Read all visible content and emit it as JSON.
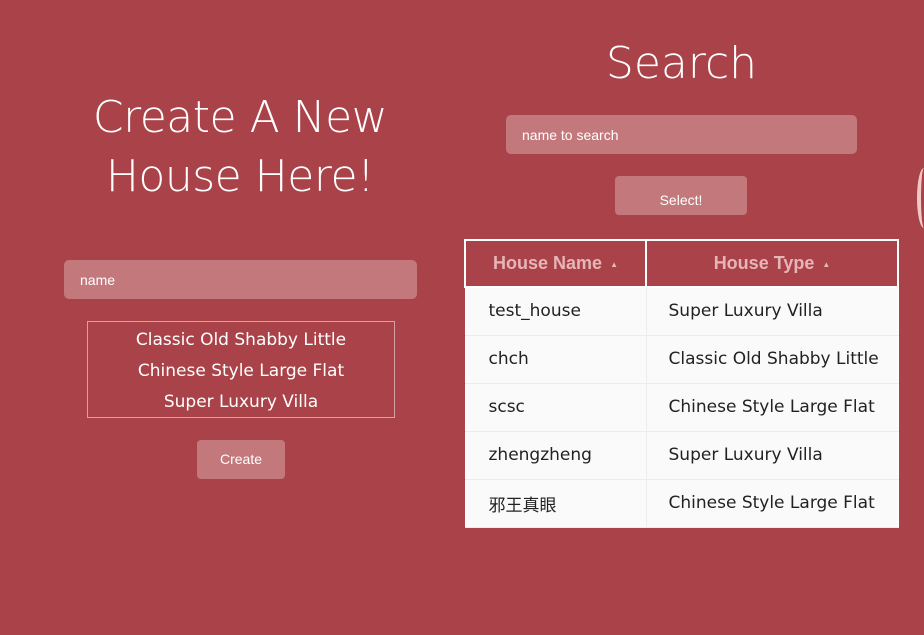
{
  "create": {
    "title": "Create A New House Here!",
    "name_placeholder": "name",
    "house_types": [
      "Classic Old Shabby Little",
      "Chinese Style Large Flat",
      "Super Luxury Villa"
    ],
    "create_label": "Create"
  },
  "search": {
    "title": "Search",
    "input_placeholder": "name to search",
    "select_label": "Select!"
  },
  "table": {
    "columns": [
      {
        "label": "House Name",
        "sort_icon": "sort-up-icon"
      },
      {
        "label": "House Type",
        "sort_icon": "sort-up-icon"
      }
    ],
    "rows": [
      {
        "name": "test_house",
        "type": "Super Luxury Villa"
      },
      {
        "name": "chch",
        "type": "Classic Old Shabby Little"
      },
      {
        "name": "scsc",
        "type": "Chinese Style Large Flat"
      },
      {
        "name": "zhengzheng",
        "type": "Super Luxury Villa"
      },
      {
        "name": "邪王真眼",
        "type": "Chinese Style Large Flat"
      }
    ]
  },
  "colors": {
    "background": "#aa4349",
    "input_bg": "#c3787c",
    "header_text": "#e6b5b8",
    "table_row_bg": "#fafafa"
  }
}
